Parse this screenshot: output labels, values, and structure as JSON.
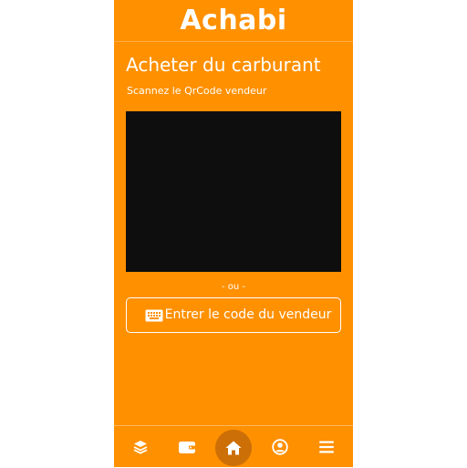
{
  "header": {
    "logo_text": "Achabi"
  },
  "page": {
    "title": "Acheter du carburant",
    "subtitle": "Scannez le QrCode vendeur",
    "separator": "- ou -",
    "code_button_label": "Entrer le code du vendeur"
  },
  "bottom_nav": {
    "items": [
      {
        "icon": "layers-icon"
      },
      {
        "icon": "wallet-icon"
      },
      {
        "icon": "home-icon",
        "active": true
      },
      {
        "icon": "user-circle-icon"
      },
      {
        "icon": "menu-icon"
      }
    ]
  },
  "colors": {
    "background": "#ff9000",
    "active_nav": "#cc6f07",
    "scanner": "#0e0e0e",
    "text": "#ffffff"
  }
}
